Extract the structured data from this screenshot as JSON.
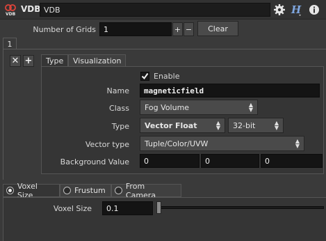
{
  "header": {
    "node_type": "VDB",
    "node_name": "VDB",
    "icons": [
      "vdb-node-icon",
      "gear-icon",
      "houdini-help-icon",
      "info-icon"
    ]
  },
  "grids": {
    "label": "Number of Grids",
    "value": "1",
    "plus_label": "+",
    "minus_label": "−",
    "clear_label": "Clear"
  },
  "instance": {
    "tab_label": "1",
    "remove_label": "✕",
    "add_label": "+"
  },
  "tabs": [
    {
      "label": "Type",
      "active": true
    },
    {
      "label": "Visualization",
      "active": false
    }
  ],
  "params": {
    "enable_label": "Enable",
    "enable_checked": true,
    "name_label": "Name",
    "name_value": "magneticfield",
    "class_label": "Class",
    "class_value": "Fog Volume",
    "type_label": "Type",
    "type_value": "Vector Float",
    "precision_value": "32-bit",
    "vector_type_label": "Vector type",
    "vector_type_value": "Tuple/Color/UVW",
    "background_label": "Background Value",
    "background_values": [
      "0",
      "0",
      "0"
    ]
  },
  "size_mode": {
    "options": [
      {
        "label": "Voxel Size",
        "selected": true
      },
      {
        "label": "Frustum",
        "selected": false
      },
      {
        "label": "From Camera",
        "selected": false
      }
    ]
  },
  "voxel": {
    "label": "Voxel Size",
    "value": "0.1"
  }
}
